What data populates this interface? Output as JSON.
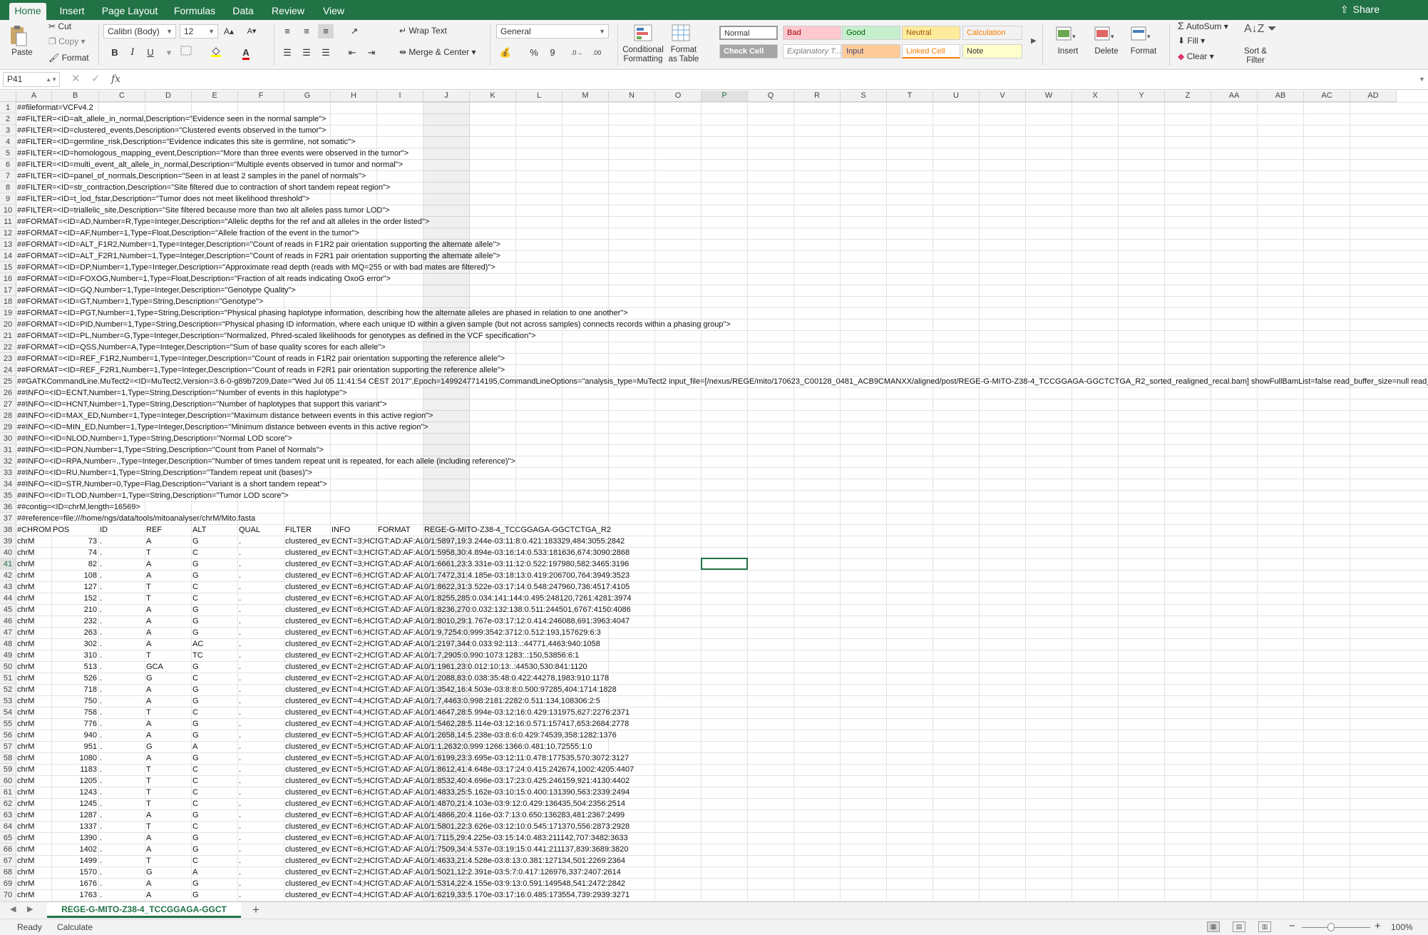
{
  "ribbon_tabs": [
    "Home",
    "Insert",
    "Page Layout",
    "Formulas",
    "Data",
    "Review",
    "View"
  ],
  "share_label": "Share",
  "clipboard": {
    "paste": "Paste",
    "cut": "Cut",
    "copy": "Copy",
    "format": "Format"
  },
  "font": {
    "name": "Calibri (Body)",
    "size": "12",
    "bold": "B",
    "italic": "I",
    "underline": "U"
  },
  "alignment": {
    "wrap": "Wrap Text",
    "merge": "Merge & Center"
  },
  "number": {
    "format": "General",
    "percent": "%",
    "comma": "9"
  },
  "styles_group": {
    "conditional": "Conditional\nFormatting",
    "format_table": "Format\nas Table"
  },
  "cell_styles": [
    {
      "label": "Normal",
      "bg": "#ffffff",
      "fg": "#333333"
    },
    {
      "label": "Bad",
      "bg": "#ffc7ce",
      "fg": "#9c0006"
    },
    {
      "label": "Good",
      "bg": "#c6efce",
      "fg": "#006100"
    },
    {
      "label": "Neutral",
      "bg": "#ffeb9c",
      "fg": "#9c5700"
    },
    {
      "label": "Calculation",
      "bg": "#f2f2f2",
      "fg": "#fa7d00"
    },
    {
      "label": "Check Cell",
      "bg": "#a5a5a5",
      "fg": "#ffffff"
    },
    {
      "label": "Explanatory T...",
      "bg": "#ffffff",
      "fg": "#7f7f7f"
    },
    {
      "label": "Input",
      "bg": "#ffcc99",
      "fg": "#3f3f76"
    },
    {
      "label": "Linked Cell",
      "bg": "#ffffff",
      "fg": "#fa7d00"
    },
    {
      "label": "Note",
      "bg": "#ffffcc",
      "fg": "#333333"
    }
  ],
  "cells_group": {
    "insert": "Insert",
    "delete": "Delete",
    "format": "Format"
  },
  "editing": {
    "autosum": "AutoSum",
    "fill": "Fill",
    "clear": "Clear",
    "sort": "Sort &\nFilter"
  },
  "formula_bar": {
    "name_box": "P41",
    "fx": "fx",
    "value": ""
  },
  "columns": [
    "A",
    "B",
    "C",
    "D",
    "E",
    "F",
    "G",
    "H",
    "I",
    "J",
    "K",
    "L",
    "M",
    "N",
    "O",
    "P",
    "Q",
    "R",
    "S",
    "T",
    "U",
    "V",
    "W",
    "X",
    "Y",
    "Z",
    "AA",
    "AB",
    "AC",
    "AD"
  ],
  "selected_col": "P",
  "selected_row": 41,
  "header_lines": [
    "##fileformat=VCFv4.2",
    "##FILTER=<ID=alt_allele_in_normal,Description=\"Evidence seen in the normal sample\">",
    "##FILTER=<ID=clustered_events,Description=\"Clustered events observed in the tumor\">",
    "##FILTER=<ID=germline_risk,Description=\"Evidence indicates this site is germline, not somatic\">",
    "##FILTER=<ID=homologous_mapping_event,Description=\"More than three events were observed in the tumor\">",
    "##FILTER=<ID=multi_event_alt_allele_in_normal,Description=\"Multiple events observed in tumor and normal\">",
    "##FILTER=<ID=panel_of_normals,Description=\"Seen in at least 2 samples in the panel of normals\">",
    "##FILTER=<ID=str_contraction,Description=\"Site filtered due to contraction of short tandem repeat region\">",
    "##FILTER=<ID=t_lod_fstar,Description=\"Tumor does not meet likelihood threshold\">",
    "##FILTER=<ID=triallelic_site,Description=\"Site filtered because more than two alt alleles pass tumor LOD\">",
    "##FORMAT=<ID=AD,Number=R,Type=Integer,Description=\"Allelic depths for the ref and alt alleles in the order listed\">",
    "##FORMAT=<ID=AF,Number=1,Type=Float,Description=\"Allele fraction of the event in the tumor\">",
    "##FORMAT=<ID=ALT_F1R2,Number=1,Type=Integer,Description=\"Count of reads in F1R2 pair orientation supporting the alternate allele\">",
    "##FORMAT=<ID=ALT_F2R1,Number=1,Type=Integer,Description=\"Count of reads in F2R1 pair orientation supporting the alternate allele\">",
    "##FORMAT=<ID=DP,Number=1,Type=Integer,Description=\"Approximate read depth (reads with MQ=255 or with bad mates are filtered)\">",
    "##FORMAT=<ID=FOXOG,Number=1,Type=Float,Description=\"Fraction of alt reads indicating OxoG error\">",
    "##FORMAT=<ID=GQ,Number=1,Type=Integer,Description=\"Genotype Quality\">",
    "##FORMAT=<ID=GT,Number=1,Type=String,Description=\"Genotype\">",
    "##FORMAT=<ID=PGT,Number=1,Type=String,Description=\"Physical phasing haplotype information, describing how the alternate alleles are phased in relation to one another\">",
    "##FORMAT=<ID=PID,Number=1,Type=String,Description=\"Physical phasing ID information, where each unique ID within a given sample (but not across samples) connects records within a phasing group\">",
    "##FORMAT=<ID=PL,Number=G,Type=Integer,Description=\"Normalized, Phred-scaled likelihoods for genotypes as defined in the VCF specification\">",
    "##FORMAT=<ID=QSS,Number=A,Type=Integer,Description=\"Sum of base quality scores for each allele\">",
    "##FORMAT=<ID=REF_F1R2,Number=1,Type=Integer,Description=\"Count of reads in F1R2 pair orientation supporting the reference allele\">",
    "##FORMAT=<ID=REF_F2R1,Number=1,Type=Integer,Description=\"Count of reads in F2R1 pair orientation supporting the reference allele\">",
    "##GATKCommandLine.MuTect2=<ID=MuTect2,Version=3.6-0-g89b7209,Date=\"Wed Jul 05 11:41:54 CEST 2017\",Epoch=1499247714195,CommandLineOptions=\"analysis_type=MuTect2 input_file=[/nexus/REGE/mito/170623_C00128_0481_ACB9CMANXX/aligned/post/REGE-G-MITO-Z38-4_TCCGGAGA-GGCTCTGA_R2_sorted_realigned_recal.bam] showFullBamList=false read_buffer_size=null read_filte",
    "##INFO=<ID=ECNT,Number=1,Type=String,Description=\"Number of events in this haplotype\">",
    "##INFO=<ID=HCNT,Number=1,Type=String,Description=\"Number of haplotypes that support this variant\">",
    "##INFO=<ID=MAX_ED,Number=1,Type=Integer,Description=\"Maximum distance between events in this active region\">",
    "##INFO=<ID=MIN_ED,Number=1,Type=Integer,Description=\"Minimum distance between events in this active region\">",
    "##INFO=<ID=NLOD,Number=1,Type=String,Description=\"Normal LOD score\">",
    "##INFO=<ID=PON,Number=1,Type=String,Description=\"Count from Panel of Normals\">",
    "##INFO=<ID=RPA,Number=.,Type=Integer,Description=\"Number of times tandem repeat unit is repeated, for each allele (including reference)\">",
    "##INFO=<ID=RU,Number=1,Type=String,Description=\"Tandem repeat unit (bases)\">",
    "##INFO=<ID=STR,Number=0,Type=Flag,Description=\"Variant is a short tandem repeat\">",
    "##INFO=<ID=TLOD,Number=1,Type=String,Description=\"Tumor LOD score\">",
    "##contig=<ID=chrM,length=16569>",
    "##reference=file:///home/ngs/data/tools/mitoanalyser/chrM/Mito.fasta"
  ],
  "table_header": [
    "#CHROM",
    "POS",
    "ID",
    "REF",
    "ALT",
    "QUAL",
    "FILTER",
    "INFO",
    "FORMAT",
    "REGE-G-MITO-Z38-4_TCCGGAGA-GGCTCTGA_R2"
  ],
  "records": [
    [
      "chrM",
      "73",
      ".",
      "A",
      "G",
      ".",
      "clustered_ev",
      "ECNT=3;HCN",
      "GT:AD:AF:AL",
      "0/1:5897,19:3.244e-03:11:8:0.421:183329,484:3055:2842"
    ],
    [
      "chrM",
      "74",
      ".",
      "T",
      "C",
      ".",
      "clustered_ev",
      "ECNT=3;HCN",
      "GT:AD:AF:AL",
      "0/1:5958,30:4.894e-03:16:14:0.533:181636,674:3090:2868"
    ],
    [
      "chrM",
      "82",
      ".",
      "A",
      "G",
      ".",
      "clustered_ev",
      "ECNT=3;HCN",
      "GT:AD:AF:AL",
      "0/1:6661,23:3.331e-03:11:12:0.522:197980,582:3465:3196"
    ],
    [
      "chrM",
      "108",
      ".",
      "A",
      "G",
      ".",
      "clustered_ev",
      "ECNT=6;HCN",
      "GT:AD:AF:AL",
      "0/1:7472,31:4.185e-03:18:13:0.419:206700,764:3949:3523"
    ],
    [
      "chrM",
      "127",
      ".",
      "T",
      "C",
      ".",
      "clustered_ev",
      "ECNT=6;HCN",
      "GT:AD:AF:AL",
      "0/1:8622,31:3.522e-03:17:14:0.548:247960,736:4517:4105"
    ],
    [
      "chrM",
      "152",
      ".",
      "T",
      "C",
      ".",
      "clustered_ev",
      "ECNT=6;HCN",
      "GT:AD:AF:AL",
      "0/1:8255,285:0.034:141:144:0.495:248120,7261:4281:3974"
    ],
    [
      "chrM",
      "210",
      ".",
      "A",
      "G",
      ".",
      "clustered_ev",
      "ECNT=6;HCN",
      "GT:AD:AF:AL",
      "0/1:8236,270:0.032:132:138:0.511:244501,6767:4150:4086"
    ],
    [
      "chrM",
      "232",
      ".",
      "A",
      "G",
      ".",
      "clustered_ev",
      "ECNT=6;HCN",
      "GT:AD:AF:AL",
      "0/1:8010,29:1.767e-03:17:12:0.414:246088,691:3963:4047"
    ],
    [
      "chrM",
      "263",
      ".",
      "A",
      "G",
      ".",
      "clustered_ev",
      "ECNT=6;HCN",
      "GT:AD:AF:AL",
      "0/1:9,7254:0.999:3542:3712:0.512:193,157629:6:3"
    ],
    [
      "chrM",
      "302",
      ".",
      "A",
      "AC",
      ".",
      "clustered_ev",
      "ECNT=2;HCN",
      "GT:AD:AF:AL",
      "0/1:2197,344:0.033:92:113:.:44771,4463:940:1058"
    ],
    [
      "chrM",
      "310",
      ".",
      "T",
      "TC",
      ".",
      "clustered_ev",
      "ECNT=2;HCN",
      "GT:AD:AF:AL",
      "0/1:7,2905:0.990:1073:1283:.:150,53856:6:1"
    ],
    [
      "chrM",
      "513",
      ".",
      "GCA",
      "G",
      ".",
      "clustered_ev",
      "ECNT=2;HCN",
      "GT:AD:AF:AL",
      "0/1:1961,23:0.012:10:13:.:44530,530:841:1120"
    ],
    [
      "chrM",
      "526",
      ".",
      "G",
      "C",
      ".",
      "clustered_ev",
      "ECNT=2;HCN",
      "GT:AD:AF:AL",
      "0/1:2088,83:0.038:35:48:0.422:44278,1983:910:1178"
    ],
    [
      "chrM",
      "718",
      ".",
      "A",
      "G",
      ".",
      "clustered_ev",
      "ECNT=4;HCN",
      "GT:AD:AF:AL",
      "0/1:3542,16:4.503e-03:8:8:0.500:97285,404:1714:1828"
    ],
    [
      "chrM",
      "750",
      ".",
      "A",
      "G",
      ".",
      "clustered_ev",
      "ECNT=4;HCN",
      "GT:AD:AF:AL",
      "0/1:7,4463:0.998:2181:2282:0.511:134,108306:2:5"
    ],
    [
      "chrM",
      "758",
      ".",
      "T",
      "C",
      ".",
      "clustered_ev",
      "ECNT=4;HCN",
      "GT:AD:AF:AL",
      "0/1:4647,28:5.994e-03:12:16:0.429:131975,627:2276:2371"
    ],
    [
      "chrM",
      "776",
      ".",
      "A",
      "G",
      ".",
      "clustered_ev",
      "ECNT=4;HCN",
      "GT:AD:AF:AL",
      "0/1:5462,28:5.114e-03:12:16:0.571:157417,653:2684:2778"
    ],
    [
      "chrM",
      "940",
      ".",
      "A",
      "G",
      ".",
      "clustered_ev",
      "ECNT=5;HCN",
      "GT:AD:AF:AL",
      "0/1:2658,14:5.238e-03:8:6:0.429:74539,358:1282:1376"
    ],
    [
      "chrM",
      "951",
      ".",
      "G",
      "A",
      ".",
      "clustered_ev",
      "ECNT=5;HCN",
      "GT:AD:AF:AL",
      "0/1:1,2632:0.999:1266:1366:0.481:10,72555:1:0"
    ],
    [
      "chrM",
      "1080",
      ".",
      "A",
      "G",
      ".",
      "clustered_ev",
      "ECNT=5;HCN",
      "GT:AD:AF:AL",
      "0/1:6199,23:3.695e-03:12:11:0.478:177535,570:3072:3127"
    ],
    [
      "chrM",
      "1183",
      ".",
      "T",
      "C",
      ".",
      "clustered_ev",
      "ECNT=5;HCN",
      "GT:AD:AF:AL",
      "0/1:8612,41:4.648e-03:17:24:0.415:242674,1002:4205:4407"
    ],
    [
      "chrM",
      "1205",
      ".",
      "T",
      "C",
      ".",
      "clustered_ev",
      "ECNT=5;HCN",
      "GT:AD:AF:AL",
      "0/1:8532,40:4.696e-03:17:23:0.425:246159,921:4130:4402"
    ],
    [
      "chrM",
      "1243",
      ".",
      "T",
      "C",
      ".",
      "clustered_ev",
      "ECNT=6;HCN",
      "GT:AD:AF:AL",
      "0/1:4833,25:5.162e-03:10:15:0.400:131390,563:2339:2494"
    ],
    [
      "chrM",
      "1245",
      ".",
      "T",
      "C",
      ".",
      "clustered_ev",
      "ECNT=6;HCN",
      "GT:AD:AF:AL",
      "0/1:4870,21:4.103e-03:9:12:0.429:136435,504:2356:2514"
    ],
    [
      "chrM",
      "1287",
      ".",
      "A",
      "G",
      ".",
      "clustered_ev",
      "ECNT=6;HCN",
      "GT:AD:AF:AL",
      "0/1:4866,20:4.116e-03:7:13:0.650:136283,481:2367:2499"
    ],
    [
      "chrM",
      "1337",
      ".",
      "T",
      "C",
      ".",
      "clustered_ev",
      "ECNT=6;HCN",
      "GT:AD:AF:AL",
      "0/1:5801,22:3.626e-03:12:10:0.545:171370,556:2873:2928"
    ],
    [
      "chrM",
      "1390",
      ".",
      "A",
      "G",
      ".",
      "clustered_ev",
      "ECNT=6;HCN",
      "GT:AD:AF:AL",
      "0/1:7115,29:4.225e-03:15:14:0.483:211142,707:3482:3633"
    ],
    [
      "chrM",
      "1402",
      ".",
      "A",
      "G",
      ".",
      "clustered_ev",
      "ECNT=6;HCN",
      "GT:AD:AF:AL",
      "0/1:7509,34:4.537e-03:19:15:0.441:211137,839:3689:3820"
    ],
    [
      "chrM",
      "1499",
      ".",
      "T",
      "C",
      ".",
      "clustered_ev",
      "ECNT=2;HCN",
      "GT:AD:AF:AL",
      "0/1:4633,21:4.528e-03:8:13:0.381:127134,501:2269:2364"
    ],
    [
      "chrM",
      "1570",
      ".",
      "G",
      "A",
      ".",
      "clustered_ev",
      "ECNT=2;HCN",
      "GT:AD:AF:AL",
      "0/1:5021,12:2.391e-03:5:7:0.417:126976,337:2407:2614"
    ],
    [
      "chrM",
      "1676",
      ".",
      "A",
      "G",
      ".",
      "clustered_ev",
      "ECNT=4;HCN",
      "GT:AD:AF:AL",
      "0/1:5314,22:4.155e-03:9:13:0.591:149548,541:2472:2842"
    ],
    [
      "chrM",
      "1763",
      ".",
      "A",
      "G",
      ".",
      "clustered_ev",
      "ECNT=4;HCN",
      "GT:AD:AF:AL",
      "0/1:6219,33:5.170e-03:17:16:0.485:173554,739:2939:3271"
    ]
  ],
  "sheet_tab": "REGE-G-MITO-Z38-4_TCCGGAGA-GGCT",
  "status": {
    "ready": "Ready",
    "calculate": "Calculate",
    "zoom": "100%"
  }
}
